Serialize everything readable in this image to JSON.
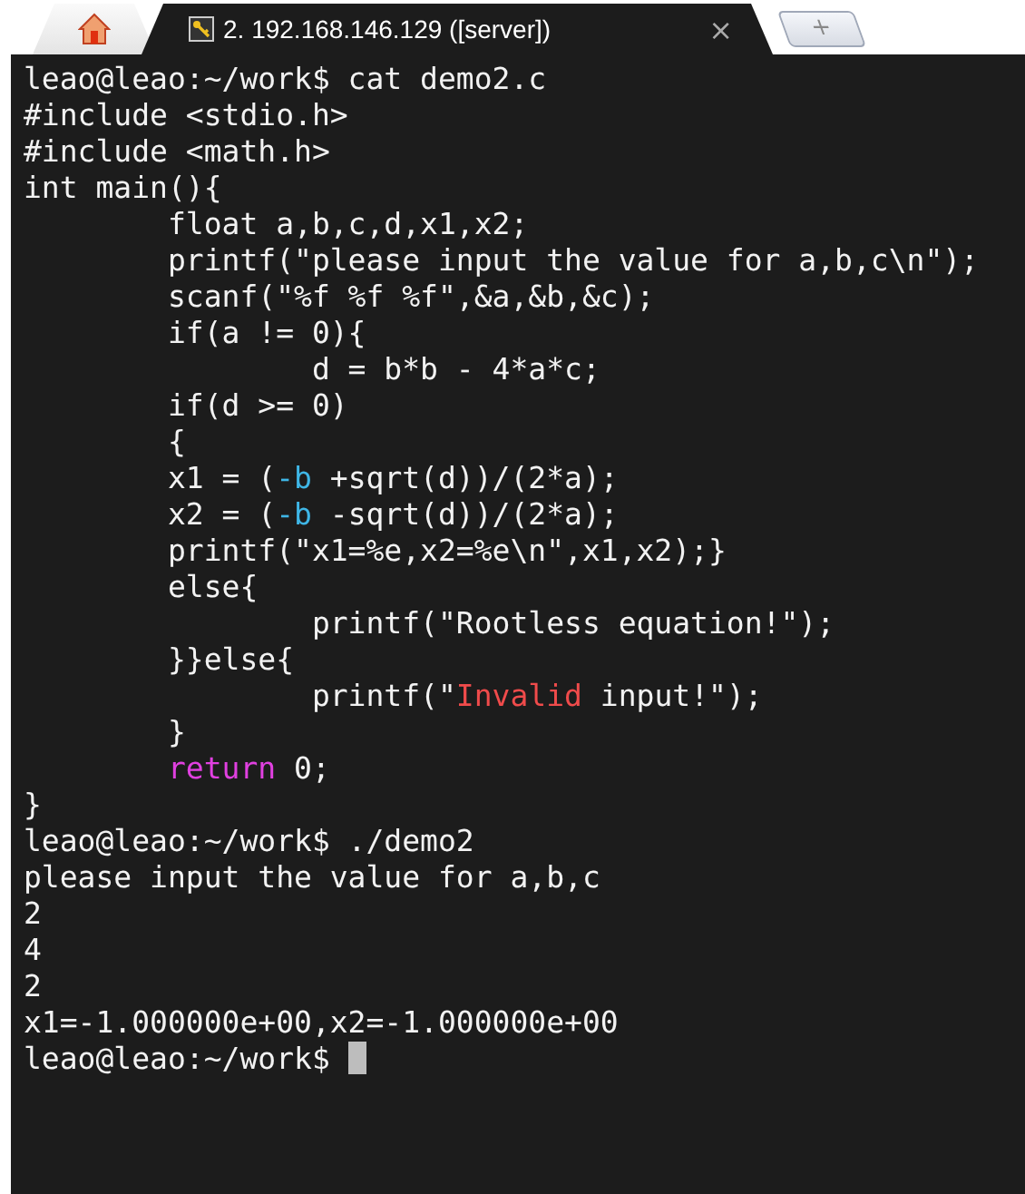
{
  "tabs": [
    {
      "kind": "home",
      "selected": false
    },
    {
      "kind": "session",
      "label": "2. 192.168.146.129 ([server])",
      "close": "×",
      "selected": true
    }
  ],
  "new_tab": {
    "label": "+"
  },
  "terminal": {
    "lines": [
      [
        {
          "text": "leao@leao:~/work$ cat demo2.c"
        }
      ],
      [
        {
          "text": "#include <stdio.h>"
        }
      ],
      [
        {
          "text": "#include <math.h>"
        }
      ],
      [
        {
          "text": "int main(){"
        }
      ],
      [
        {
          "text": "        float a,b,c,d,x1,x2;"
        }
      ],
      [
        {
          "text": "        printf(\"please input the value for a,b,c\\n\");"
        }
      ],
      [
        {
          "text": "        scanf(\"%f %f %f\",&a,&b,&c);"
        }
      ],
      [
        {
          "text": "        if(a != 0){"
        }
      ],
      [
        {
          "text": "                d = b*b - 4*a*c;"
        }
      ],
      [
        {
          "text": "        if(d >= 0)"
        }
      ],
      [
        {
          "text": "        {"
        }
      ],
      [
        {
          "text": "        x1 = ("
        },
        {
          "text": "-b",
          "color": "#3fb6e6"
        },
        {
          "text": " +sqrt(d))/(2*a);"
        }
      ],
      [
        {
          "text": "        x2 = ("
        },
        {
          "text": "-b",
          "color": "#3fb6e6"
        },
        {
          "text": " -sqrt(d))/(2*a);"
        }
      ],
      [
        {
          "text": "        printf(\"x1=%e,x2=%e\\n\",x1,x2);}"
        }
      ],
      [
        {
          "text": "        else{"
        }
      ],
      [
        {
          "text": "                printf(\"Rootless equation!\");"
        }
      ],
      [
        {
          "text": "        }}else{"
        }
      ],
      [
        {
          "text": "                printf(\""
        },
        {
          "text": "Invalid",
          "color": "#f04b4b"
        },
        {
          "text": " input!\");"
        }
      ],
      [
        {
          "text": "        }"
        }
      ],
      [
        {
          "text": "        return",
          "color": "#e040e0"
        },
        {
          "text": " 0;"
        }
      ],
      [
        {
          "text": "}"
        }
      ],
      [
        {
          "text": "leao@leao:~/work$ ./demo2"
        }
      ],
      [
        {
          "text": "please input the value for a,b,c"
        }
      ],
      [
        {
          "text": "2"
        }
      ],
      [
        {
          "text": "4"
        }
      ],
      [
        {
          "text": "2"
        }
      ],
      [
        {
          "text": "x1=-1.000000e+00,x2=-1.000000e+00"
        }
      ],
      [
        {
          "text": "leao@leao:~/work$ "
        }
      ]
    ]
  }
}
